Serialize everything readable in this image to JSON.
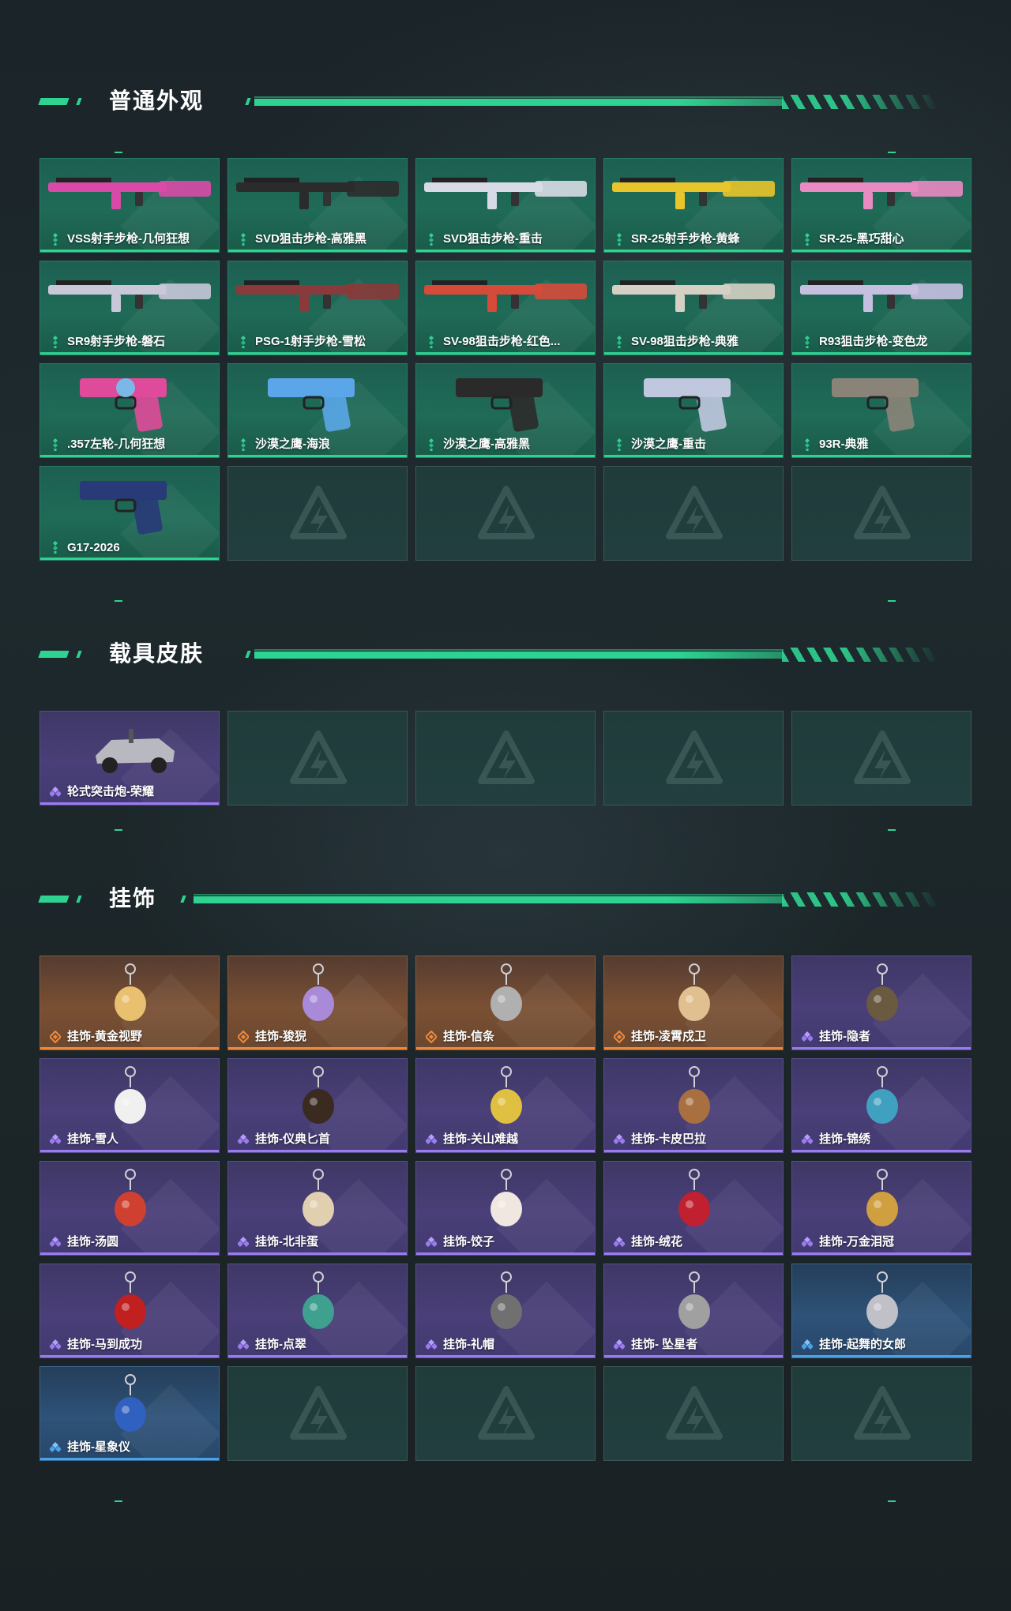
{
  "sections": [
    {
      "title": "普通外观",
      "items": [
        {
          "label": "VSS射手步枪-几何狂想",
          "rarity": "green",
          "icon": "rifle-icon"
        },
        {
          "label": "SVD狙击步枪-高雅黑",
          "rarity": "green",
          "icon": "rifle-icon"
        },
        {
          "label": "SVD狙击步枪-重击",
          "rarity": "green",
          "icon": "rifle-icon"
        },
        {
          "label": "SR-25射手步枪-黄蜂",
          "rarity": "green",
          "icon": "rifle-icon"
        },
        {
          "label": "SR-25-黑巧甜心",
          "rarity": "green",
          "icon": "rifle-icon"
        },
        {
          "label": "SR9射手步枪-磐石",
          "rarity": "green",
          "icon": "rifle-icon"
        },
        {
          "label": "PSG-1射手步枪-雪松",
          "rarity": "green",
          "icon": "rifle-icon"
        },
        {
          "label": "SV-98狙击步枪-红色...",
          "rarity": "green",
          "icon": "rifle-icon"
        },
        {
          "label": "SV-98狙击步枪-典雅",
          "rarity": "green",
          "icon": "rifle-icon"
        },
        {
          "label": "R93狙击步枪-变色龙",
          "rarity": "green",
          "icon": "rifle-icon"
        },
        {
          "label": ".357左轮-几何狂想",
          "rarity": "green",
          "icon": "revolver-icon"
        },
        {
          "label": "沙漠之鹰-海浪",
          "rarity": "green",
          "icon": "pistol-icon"
        },
        {
          "label": "沙漠之鹰-高雅黑",
          "rarity": "green",
          "icon": "pistol-icon"
        },
        {
          "label": "沙漠之鹰-重击",
          "rarity": "green",
          "icon": "pistol-icon"
        },
        {
          "label": "93R-典雅",
          "rarity": "green",
          "icon": "pistol-icon"
        },
        {
          "label": "G17-2026",
          "rarity": "green",
          "icon": "pistol-icon"
        }
      ],
      "empty_slots": 4
    },
    {
      "title": "载具皮肤",
      "items": [
        {
          "label": "轮式突击炮-荣耀",
          "rarity": "purple",
          "icon": "vehicle-icon"
        }
      ],
      "empty_slots": 4
    },
    {
      "title": "挂饰",
      "items": [
        {
          "label": "挂饰-黄金视野",
          "rarity": "orange",
          "icon": "charm-icon"
        },
        {
          "label": "挂饰-狻猊",
          "rarity": "orange",
          "icon": "charm-icon"
        },
        {
          "label": "挂饰-信条",
          "rarity": "orange",
          "icon": "charm-icon"
        },
        {
          "label": "挂饰-凌霄戍卫",
          "rarity": "orange",
          "icon": "charm-icon"
        },
        {
          "label": "挂饰-隐者",
          "rarity": "purple",
          "icon": "charm-icon"
        },
        {
          "label": "挂饰-雪人",
          "rarity": "purple",
          "icon": "charm-icon"
        },
        {
          "label": "挂饰-仪典匕首",
          "rarity": "purple",
          "icon": "charm-icon"
        },
        {
          "label": "挂饰-关山难越",
          "rarity": "purple",
          "icon": "charm-icon"
        },
        {
          "label": "挂饰-卡皮巴拉",
          "rarity": "purple",
          "icon": "charm-icon"
        },
        {
          "label": "挂饰-锦绣",
          "rarity": "purple",
          "icon": "charm-icon"
        },
        {
          "label": "挂饰-汤圆",
          "rarity": "purple",
          "icon": "charm-icon"
        },
        {
          "label": "挂饰-北非蛋",
          "rarity": "purple",
          "icon": "charm-icon"
        },
        {
          "label": "挂饰-饺子",
          "rarity": "purple",
          "icon": "charm-icon"
        },
        {
          "label": "挂饰-绒花",
          "rarity": "purple",
          "icon": "charm-icon"
        },
        {
          "label": "挂饰-万金泪冠",
          "rarity": "purple",
          "icon": "charm-icon"
        },
        {
          "label": "挂饰-马到成功",
          "rarity": "purple",
          "icon": "charm-icon"
        },
        {
          "label": "挂饰-点翠",
          "rarity": "purple",
          "icon": "charm-icon"
        },
        {
          "label": "挂饰-礼帽",
          "rarity": "purple",
          "icon": "charm-icon"
        },
        {
          "label": "挂饰- 坠星者",
          "rarity": "purple",
          "icon": "charm-icon"
        },
        {
          "label": "挂饰-起舞的女郎",
          "rarity": "blue",
          "icon": "charm-icon"
        },
        {
          "label": "挂饰-星象仪",
          "rarity": "blue",
          "icon": "charm-icon"
        }
      ],
      "empty_slots": 4
    }
  ],
  "colors": {
    "accent": "#2fd391",
    "green": "#1f6b57",
    "purple": "#4a3f78",
    "orange": "#7a5033",
    "blue": "#2e5278"
  }
}
